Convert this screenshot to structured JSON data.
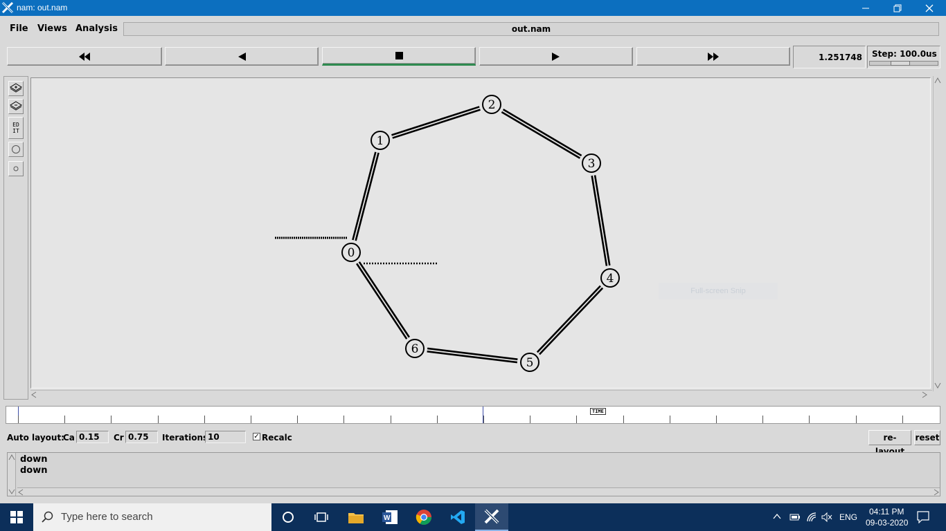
{
  "window": {
    "title": "nam: out.nam"
  },
  "menu": {
    "items": [
      "File",
      "Views",
      "Analysis"
    ],
    "filename": "out.nam"
  },
  "playback": {
    "buttons": [
      "fast-rewind",
      "rewind",
      "stop",
      "play",
      "fast-forward"
    ],
    "current_time": "1.251748",
    "step_label": "Step: 100.0us"
  },
  "tools": {
    "edit_label_line1": "ED",
    "edit_label_line2": "IT"
  },
  "network": {
    "nodes": [
      {
        "id": "0",
        "label": "0"
      },
      {
        "id": "1",
        "label": "1"
      },
      {
        "id": "2",
        "label": "2"
      },
      {
        "id": "3",
        "label": "3"
      },
      {
        "id": "4",
        "label": "4"
      },
      {
        "id": "5",
        "label": "5"
      },
      {
        "id": "6",
        "label": "6"
      }
    ],
    "links": [
      [
        "0",
        "1"
      ],
      [
        "1",
        "2"
      ],
      [
        "2",
        "3"
      ],
      [
        "3",
        "4"
      ],
      [
        "4",
        "5"
      ],
      [
        "5",
        "6"
      ],
      [
        "6",
        "0"
      ]
    ],
    "ghost_text": "Full-screen Snip"
  },
  "timeline": {
    "marker_label": "TIME"
  },
  "autolayout": {
    "label": "Auto layout:",
    "ca_label": "Ca",
    "ca_value": "0.15",
    "cr_label": "Cr",
    "cr_value": "0.75",
    "iterations_label": "Iterations",
    "iterations_value": "10",
    "recalc_label": "Recalc",
    "recalc_checked": true,
    "relayout_button": "re-layout",
    "reset_button": "reset"
  },
  "log": {
    "lines": [
      "down",
      "down"
    ]
  },
  "taskbar": {
    "search_placeholder": "Type here to search",
    "language": "ENG",
    "time": "04:11 PM",
    "date": "09-03-2020"
  },
  "colors": {
    "titlebar": "#0c6fbf",
    "taskbar": "#0c2f5a",
    "active_stop": "#2e8a4f"
  }
}
